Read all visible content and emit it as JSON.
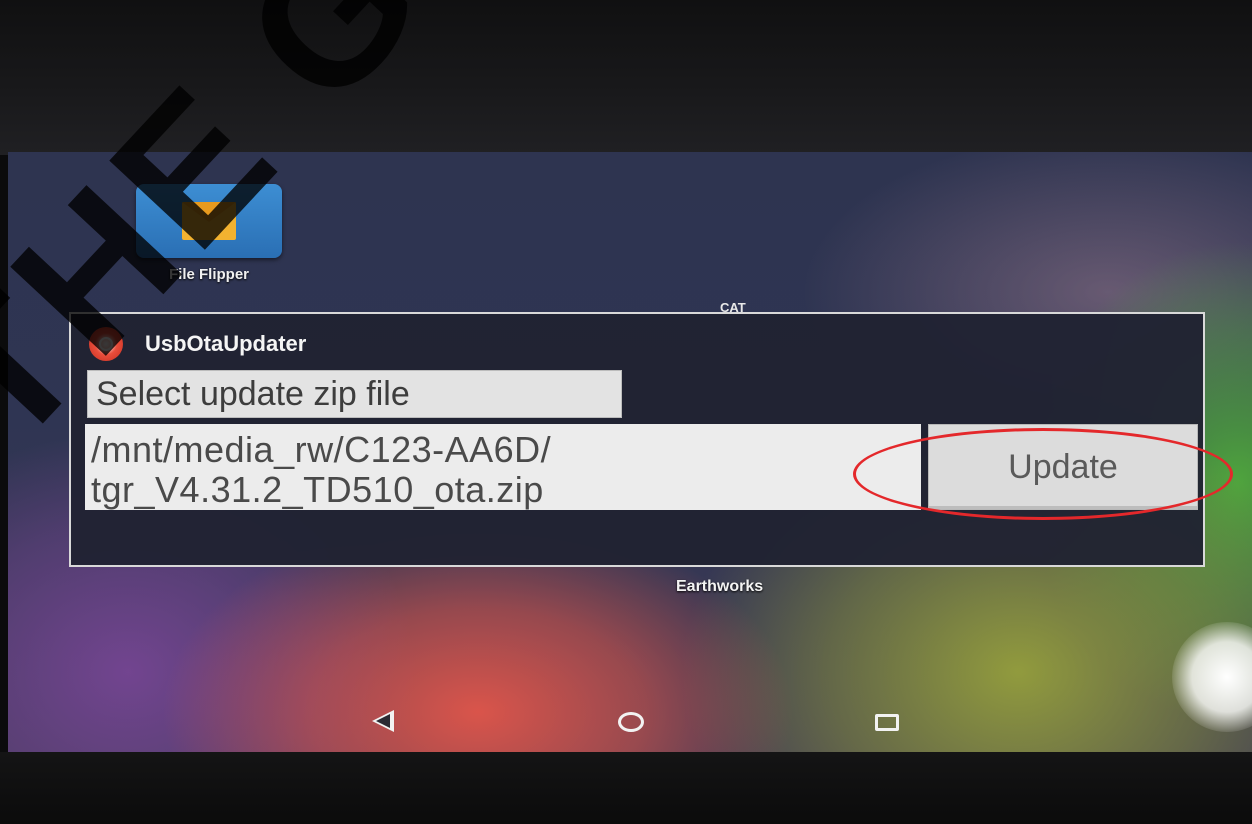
{
  "desktop": {
    "icon_label": "File Flipper",
    "brand_logo_text": "CAT",
    "bottom_label": "Earthworks"
  },
  "dialog": {
    "title": "UsbOtaUpdater",
    "select_button_label": "Select update zip file",
    "path_line1": "/mnt/media_rw/C123-AA6D/",
    "path_line2": "tgr_V4.31.2_TD510_ota.zip",
    "update_button_label": "Update"
  },
  "annotation": {
    "highlight_color": "#e4282b",
    "highlight_target": "update-button"
  },
  "navigation": {
    "back_icon": "back-triangle-icon",
    "home_icon": "home-circle-icon",
    "recents_icon": "recents-square-icon"
  },
  "watermark_text": "THE GN"
}
